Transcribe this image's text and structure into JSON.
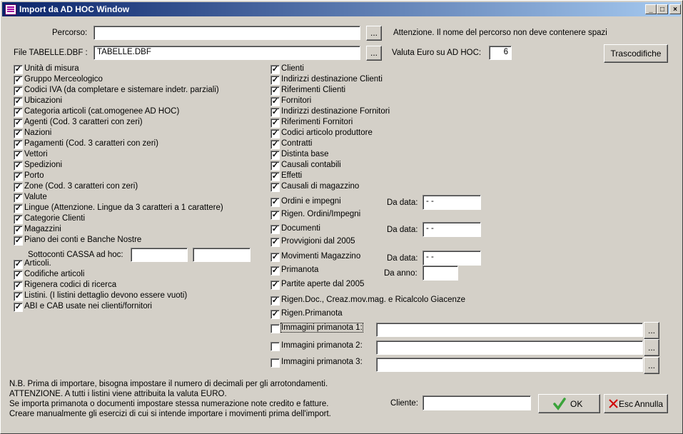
{
  "window": {
    "title": "Import da AD HOC Window"
  },
  "top": {
    "percorso_label": "Percorso:",
    "percorso_value": "",
    "file_label": "File TABELLE.DBF :",
    "file_value": "TABELLE.DBF",
    "browse": "...",
    "attenzione": "Attenzione. Il nome del percorso non deve contenere spazi",
    "valuta_label": "Valuta Euro su AD HOC:",
    "valuta_value": "6",
    "trascodifiche": "Trascodifiche"
  },
  "left_items": [
    {
      "label": "Unità di misura",
      "checked": true
    },
    {
      "label": "Gruppo Merceologico",
      "checked": true
    },
    {
      "label": "Codici IVA (da completare e sistemare indetr. parziali)",
      "checked": true
    },
    {
      "label": "Ubicazioni",
      "checked": true
    },
    {
      "label": "Categoria articoli (cat.omogenee AD HOC)",
      "checked": true
    },
    {
      "label": "Agenti (Cod. 3 caratteri con zeri)",
      "checked": true
    },
    {
      "label": "Nazioni",
      "checked": true
    },
    {
      "label": "Pagamenti (Cod. 3 caratteri con zeri)",
      "checked": true
    },
    {
      "label": "Vettori",
      "checked": true
    },
    {
      "label": "Spedizioni",
      "checked": true
    },
    {
      "label": "Porto",
      "checked": true
    },
    {
      "label": "Zone (Cod. 3 caratteri  con zeri)",
      "checked": true
    },
    {
      "label": "Valute",
      "checked": true
    },
    {
      "label": "Lingue (Attenzione. Lingue da 3 caratteri a 1 carattere)",
      "checked": true
    },
    {
      "label": "Categorie Clienti",
      "checked": true
    },
    {
      "label": "Magazzini",
      "checked": true
    },
    {
      "label": "Piano dei conti  e Banche Nostre",
      "checked": true
    }
  ],
  "sottoconti": {
    "label": "Sottoconti CASSA ad hoc:",
    "value1": "",
    "value2": ""
  },
  "left_items2": [
    {
      "label": "Articoli.",
      "checked": true
    },
    {
      "label": "Codifiche articoli",
      "checked": true
    },
    {
      "label": "Rigenera codici di ricerca",
      "checked": true
    },
    {
      "label": "Listini. (I listini dettaglio devono essere vuoti)",
      "checked": true
    },
    {
      "label": "ABI e CAB usate nei clienti/fornitori",
      "checked": true
    }
  ],
  "right_items": [
    {
      "label": "Clienti",
      "checked": true
    },
    {
      "label": "Indirizzi destinazione Clienti",
      "checked": true
    },
    {
      "label": "Riferimenti Clienti",
      "checked": true
    },
    {
      "label": "Fornitori",
      "checked": true
    },
    {
      "label": "Indirizzi destinazione Fornitori",
      "checked": true
    },
    {
      "label": "Riferimenti Fornitori",
      "checked": true
    },
    {
      "label": "Codici articolo produttore",
      "checked": true
    },
    {
      "label": "Contratti",
      "checked": true
    },
    {
      "label": "Distinta base",
      "checked": true
    },
    {
      "label": "Causali contabili",
      "checked": true
    },
    {
      "label": "Effetti",
      "checked": true
    },
    {
      "label": "Causali di magazzino",
      "checked": true
    }
  ],
  "right_items2": {
    "ordini": "Ordini e impegni",
    "rigen_ordini": "Rigen. Ordini/Impegni",
    "documenti": "Documenti",
    "provvigioni": "Provvigioni dal 2005",
    "movimenti": "Movimenti Magazzino",
    "primanota": "Primanota",
    "partite": "Partite aperte dal 2005",
    "rigen_doc": "Rigen.Doc., Creaz.mov.mag. e Ricalcolo Giacenze",
    "rigen_primanota": "Rigen.Primanota",
    "img1": "Immagini primanota 1:",
    "img2": "Immagini primanota 2:",
    "img3": "Immagini primanota 3:",
    "checked": "✓"
  },
  "dates": {
    "da_data": "Da data:",
    "da_anno": "Da anno:",
    "date_value": "  -  -"
  },
  "notes": {
    "line1": "N.B. Prima di importare, bisogna impostare il numero di decimali per gli arrotondamenti.",
    "line2": "ATTENZIONE. A tutti i listini viene attribuita la valuta EURO.",
    "line3": "Se importa primanota o documenti impostare stessa numerazione note credito e fatture.",
    "line4": "Creare manualmente gli esercizi di cui si intende importare i movimenti prima dell'import."
  },
  "bottom": {
    "cliente_label": "Cliente:",
    "cliente_value": "",
    "ok": "OK",
    "esc": "Esc",
    "annulla": "Annulla"
  },
  "colors": {
    "title_start": "#0a246a",
    "title_end": "#a6caf0",
    "face": "#d4d0c8",
    "ok_check": "#3aa33a",
    "x_red": "#d00000"
  }
}
